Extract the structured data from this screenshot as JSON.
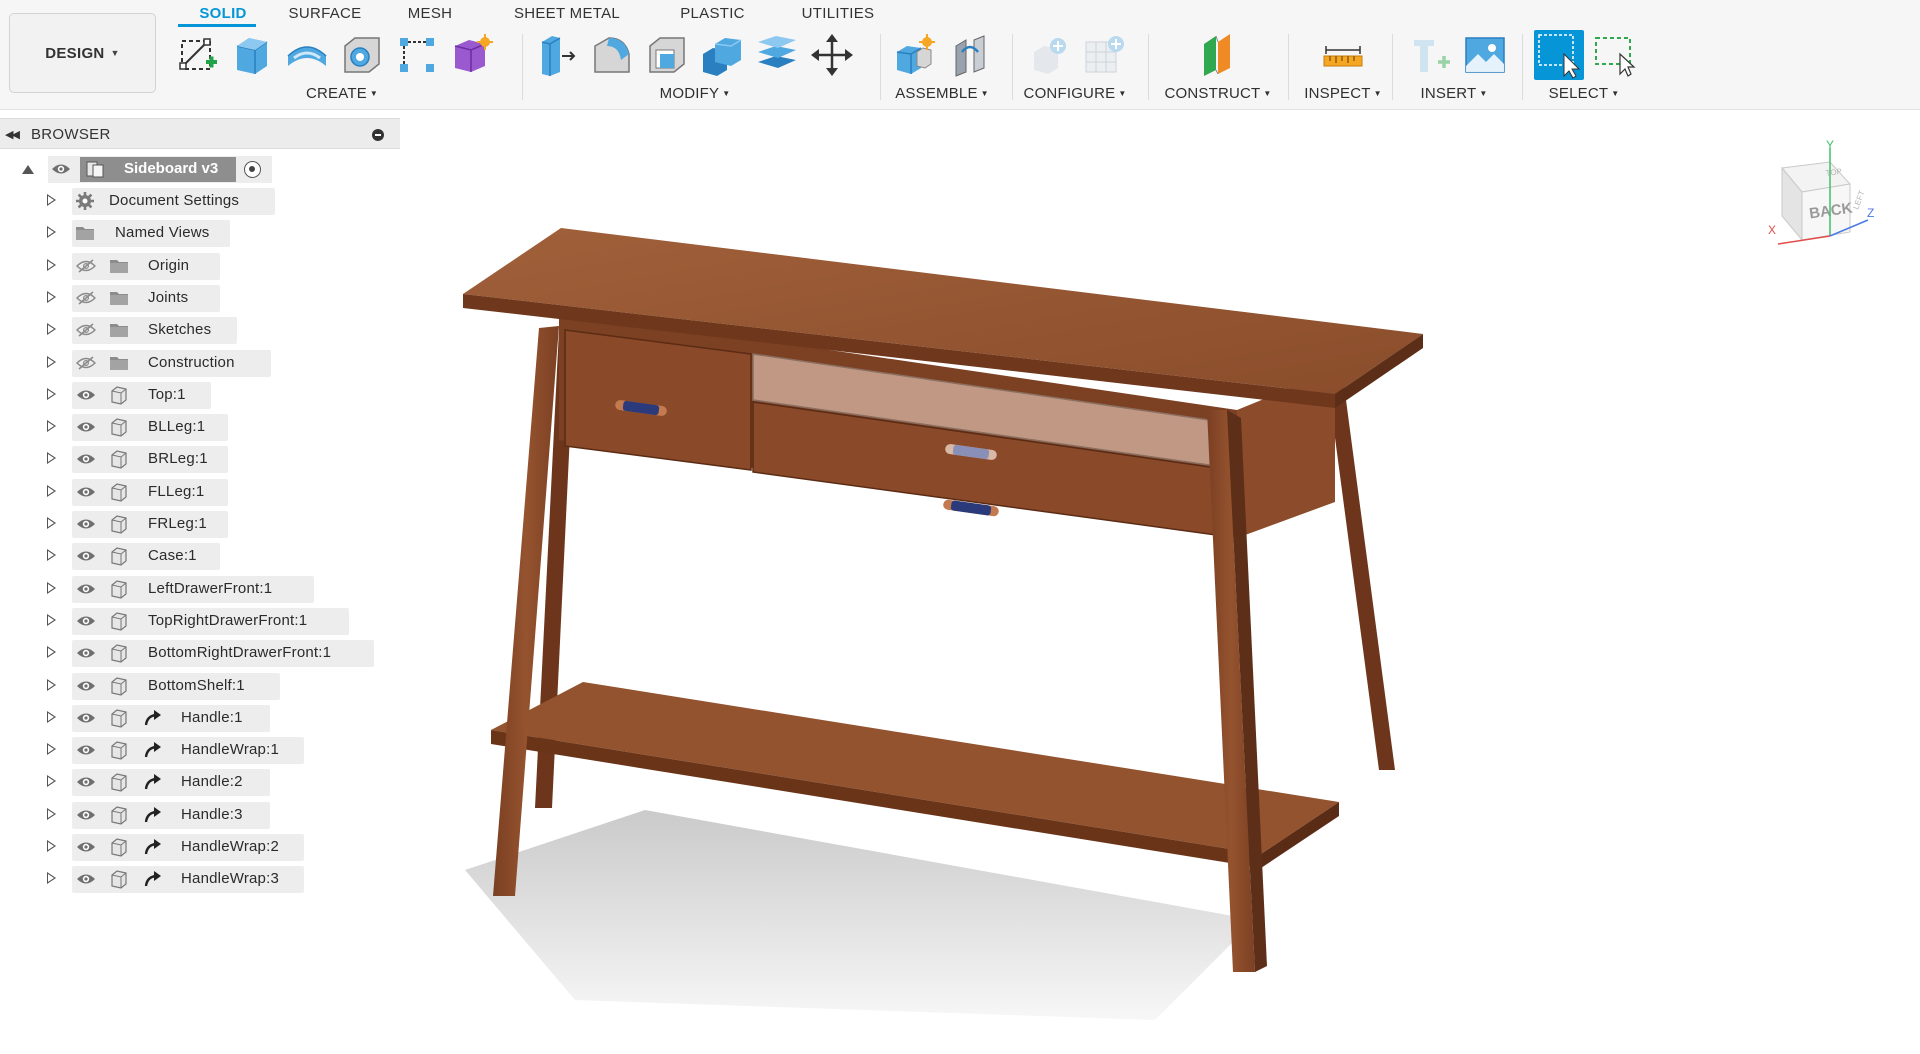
{
  "toolbar": {
    "workspace": {
      "label": "DESIGN"
    },
    "tabs": [
      {
        "label": "SOLID",
        "active": true
      },
      {
        "label": "SURFACE",
        "active": false
      },
      {
        "label": "MESH",
        "active": false
      },
      {
        "label": "SHEET METAL",
        "active": false
      },
      {
        "label": "PLASTIC",
        "active": false
      },
      {
        "label": "UTILITIES",
        "active": false
      }
    ],
    "groups": {
      "create": {
        "label": "CREATE",
        "icons": [
          "create-sketch-icon",
          "extrude-icon",
          "revolve-icon",
          "hole-icon",
          "pattern-icon",
          "form-icon"
        ]
      },
      "modify": {
        "label": "MODIFY",
        "icons": [
          "press-pull-icon",
          "fillet-icon",
          "shell-icon",
          "combine-icon",
          "offset-face-icon",
          "move-copy-icon"
        ]
      },
      "assemble": {
        "label": "ASSEMBLE",
        "icons": [
          "new-component-icon",
          "joint-icon"
        ]
      },
      "configure": {
        "label": "CONFIGURE",
        "icons": [
          "configure-add-icon",
          "configure-table-icon"
        ]
      },
      "construct": {
        "label": "CONSTRUCT",
        "icons": [
          "offset-plane-icon"
        ]
      },
      "inspect": {
        "label": "INSPECT",
        "icons": [
          "measure-icon"
        ]
      },
      "insert": {
        "label": "INSERT",
        "icons": [
          "insert-derive-icon",
          "canvas-image-icon"
        ]
      },
      "select": {
        "label": "SELECT",
        "icons": [
          "select-icon",
          "window-select-icon"
        ]
      }
    },
    "colors": {
      "accent": "#0696d7",
      "toolbar_bg": "#f6f6f6"
    }
  },
  "browser": {
    "title": "BROWSER",
    "root": {
      "label": "Sideboard v3"
    },
    "items": [
      {
        "label": "Document Settings",
        "type": "settings",
        "eye": "none"
      },
      {
        "label": "Named Views",
        "type": "folder",
        "eye": "none"
      },
      {
        "label": "Origin",
        "type": "folder",
        "eye": "hidden"
      },
      {
        "label": "Joints",
        "type": "folder",
        "eye": "hidden"
      },
      {
        "label": "Sketches",
        "type": "folder",
        "eye": "hidden"
      },
      {
        "label": "Construction",
        "type": "folder",
        "eye": "hidden"
      },
      {
        "label": "Top:1",
        "type": "component",
        "eye": "visible"
      },
      {
        "label": "BLLeg:1",
        "type": "component",
        "eye": "visible"
      },
      {
        "label": "BRLeg:1",
        "type": "component",
        "eye": "visible"
      },
      {
        "label": "FLLeg:1",
        "type": "component",
        "eye": "visible"
      },
      {
        "label": "FRLeg:1",
        "type": "component",
        "eye": "visible"
      },
      {
        "label": "Case:1",
        "type": "component",
        "eye": "visible"
      },
      {
        "label": "LeftDrawerFront:1",
        "type": "component",
        "eye": "visible"
      },
      {
        "label": "TopRightDrawerFront:1",
        "type": "component",
        "eye": "visible"
      },
      {
        "label": "BottomRightDrawerFront:1",
        "type": "component",
        "eye": "visible"
      },
      {
        "label": "BottomShelf:1",
        "type": "component",
        "eye": "visible"
      },
      {
        "label": "Handle:1",
        "type": "linked",
        "eye": "visible"
      },
      {
        "label": "HandleWrap:1",
        "type": "linked",
        "eye": "visible"
      },
      {
        "label": "Handle:2",
        "type": "linked",
        "eye": "visible"
      },
      {
        "label": "Handle:3",
        "type": "linked",
        "eye": "visible"
      },
      {
        "label": "HandleWrap:2",
        "type": "linked",
        "eye": "visible"
      },
      {
        "label": "HandleWrap:3",
        "type": "linked",
        "eye": "visible"
      }
    ]
  },
  "viewcube": {
    "face_front": "BACK",
    "face_side": "LEFT",
    "face_top": "TOP",
    "axis_x": "X",
    "axis_y": "Y",
    "axis_z": "Z"
  },
  "model": {
    "wood_color": "#8b4a2b",
    "handle_color": "#2b3a7a"
  }
}
